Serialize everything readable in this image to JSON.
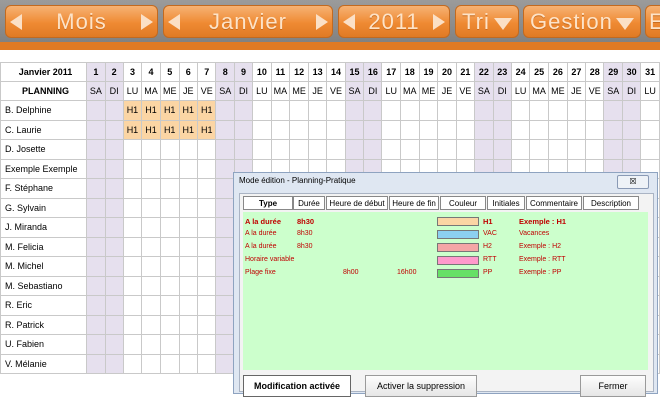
{
  "toolbar": {
    "month_label": "Mois",
    "month_value": "Janvier",
    "year_value": "2011",
    "sort_label": "Tri",
    "manage_label": "Gestion",
    "extra_label": "E"
  },
  "grid": {
    "title": "Janvier 2011",
    "subtitle": "PLANNING",
    "days": [
      "1",
      "2",
      "3",
      "4",
      "5",
      "6",
      "7",
      "8",
      "9",
      "10",
      "11",
      "12",
      "13",
      "14",
      "15",
      "16",
      "17",
      "18",
      "19",
      "20",
      "21",
      "22",
      "23",
      "24",
      "25",
      "26",
      "27",
      "28",
      "29",
      "30",
      "31"
    ],
    "weekdays": [
      "SA",
      "DI",
      "LU",
      "MA",
      "ME",
      "JE",
      "VE",
      "SA",
      "DI",
      "LU",
      "MA",
      "ME",
      "JE",
      "VE",
      "SA",
      "DI",
      "LU",
      "MA",
      "ME",
      "JE",
      "VE",
      "SA",
      "DI",
      "LU",
      "MA",
      "ME",
      "JE",
      "VE",
      "SA",
      "DI",
      "LU"
    ],
    "people": [
      "B. Delphine",
      "C. Laurie",
      "D. Josette",
      "Exemple Exemple",
      "F. Stéphane",
      "G. Sylvain",
      "J. Miranda",
      "M. Felicia",
      "M. Michel",
      "M. Sebastiano",
      "R. Eric",
      "R. Patrick",
      "U. Fabien",
      "V. Mélanie"
    ],
    "shift_code": "H1"
  },
  "dialog": {
    "title": "Mode édition - Planning-Pratique",
    "close_label": "☒",
    "columns": [
      "Type",
      "Durée",
      "Heure de début",
      "Heure de fin",
      "Couleur",
      "Initiales",
      "Commentaire",
      "Description"
    ],
    "rows": [
      {
        "type": "A la durée",
        "duree": "8h30",
        "debut": "",
        "fin": "",
        "color": "#fbd5a4",
        "initiales": "H1",
        "commentaire": "Exemple : H1",
        "bold": true
      },
      {
        "type": "A la durée",
        "duree": "8h30",
        "debut": "",
        "fin": "",
        "color": "#8ccff0",
        "initiales": "VAC",
        "commentaire": "Vacances",
        "bold": false
      },
      {
        "type": "A la durée",
        "duree": "8h30",
        "debut": "",
        "fin": "",
        "color": "#f4a6a6",
        "initiales": "H2",
        "commentaire": "Exemple : H2",
        "bold": false
      },
      {
        "type": "Horaire variable",
        "duree": "",
        "debut": "",
        "fin": "",
        "color": "#ff99cc",
        "initiales": "RTT",
        "commentaire": "Exemple : RTT",
        "bold": false
      },
      {
        "type": "Plage fixe",
        "duree": "",
        "debut": "8h00",
        "fin": "16h00",
        "color": "#66e066",
        "initiales": "PP",
        "commentaire": "Exemple : PP",
        "bold": false
      }
    ],
    "btn_modif": "Modification activée",
    "btn_suppr": "Activer la suppression",
    "btn_close": "Fermer"
  }
}
